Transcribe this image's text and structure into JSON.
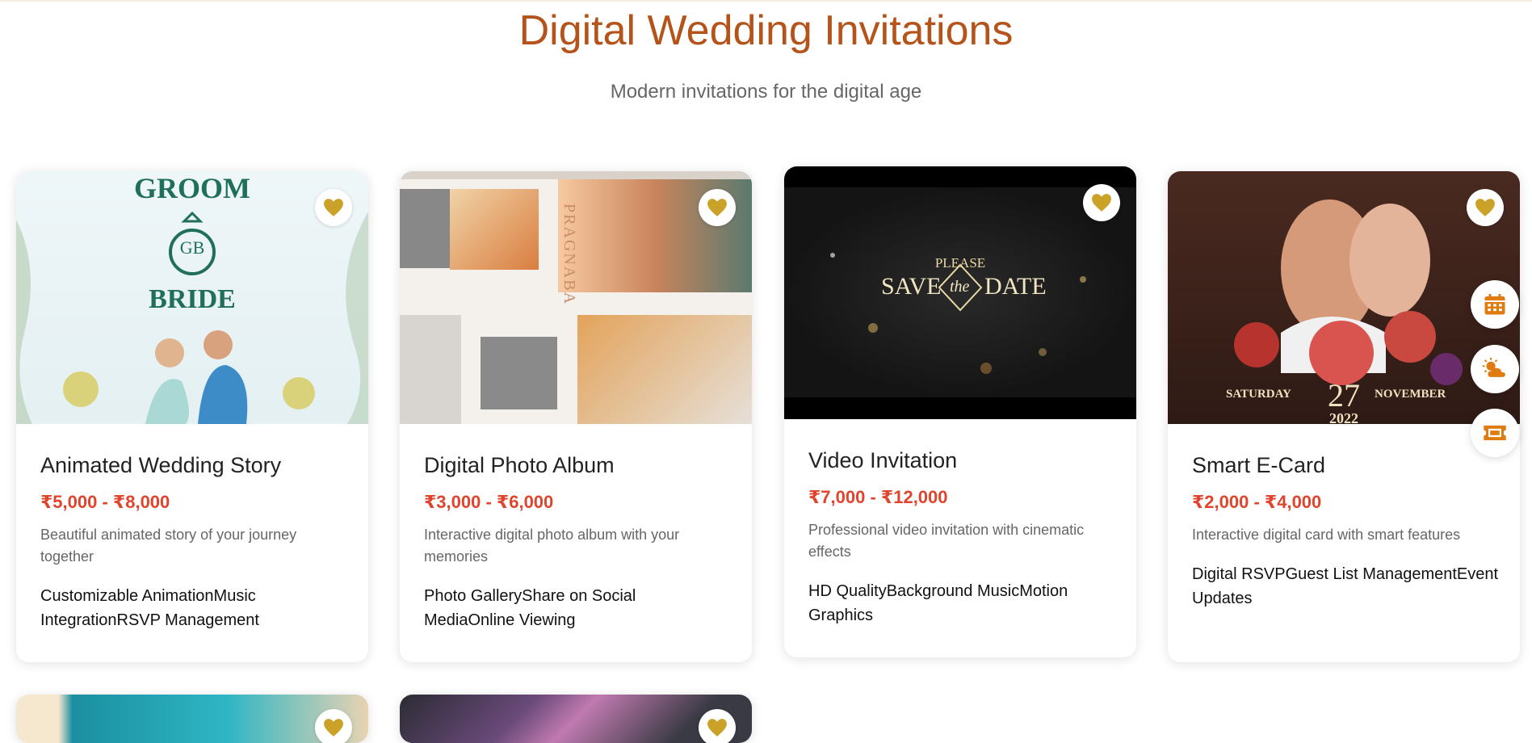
{
  "page": {
    "title": "Digital Wedding Invitations",
    "subtitle": "Modern invitations for the digital age"
  },
  "colors": {
    "accent": "#b5541a",
    "price": "#e0442d",
    "heart": "#c9a227"
  },
  "cards": [
    {
      "title": "Animated Wedding Story",
      "price": "₹5,000 - ₹8,000",
      "description": "Beautiful animated story of your journey together",
      "features": "Customizable AnimationMusic IntegrationRSVP Management",
      "image_text": {
        "groom": "GROOM",
        "monogram": "GB",
        "bride": "BRIDE"
      },
      "icon": "heart-icon"
    },
    {
      "title": "Digital Photo Album",
      "price": "₹3,000 - ₹6,000",
      "description": "Interactive digital photo album with your memories",
      "features": "Photo GalleryShare on Social MediaOnline Viewing",
      "image_text": {
        "name": "PRAGNABA"
      },
      "icon": "heart-icon"
    },
    {
      "title": "Video Invitation",
      "price": "₹7,000 - ₹12,000",
      "description": "Professional video invitation with cinematic effects",
      "features": "HD QualityBackground MusicMotion Graphics",
      "image_text": {
        "please": "PLEASE",
        "save": "SAVE",
        "the": "the",
        "date": "DATE"
      },
      "icon": "heart-icon"
    },
    {
      "title": "Smart E-Card",
      "price": "₹2,000 - ₹4,000",
      "description": "Interactive digital card with smart features",
      "features": "Digital RSVPGuest List ManagementEvent Updates",
      "image_text": {
        "day": "SATURDAY",
        "date": "27",
        "month": "NOVEMBER",
        "year": "2022"
      },
      "icon": "heart-icon"
    }
  ],
  "side_buttons": [
    {
      "name": "calendar-icon"
    },
    {
      "name": "weather-icon"
    },
    {
      "name": "ticket-icon"
    }
  ]
}
